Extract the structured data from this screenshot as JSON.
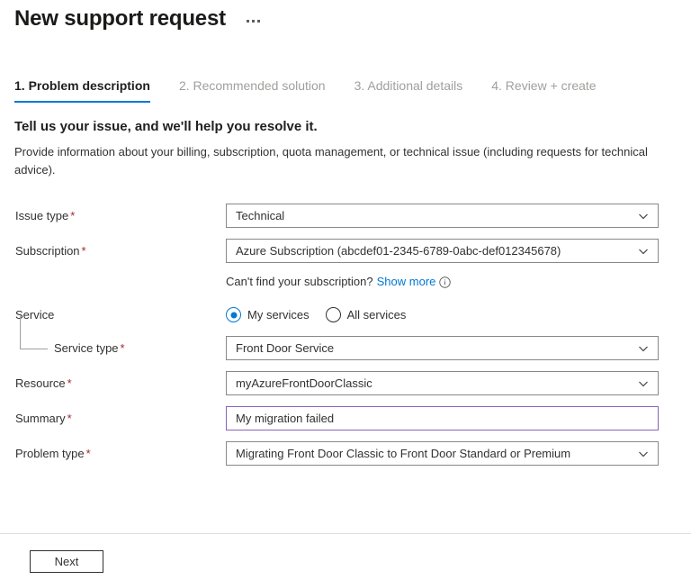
{
  "header": {
    "title": "New support request",
    "more_menu": "..."
  },
  "tabs": [
    {
      "label": "1. Problem description",
      "active": true
    },
    {
      "label": "2. Recommended solution",
      "active": false
    },
    {
      "label": "3. Additional details",
      "active": false
    },
    {
      "label": "4. Review + create",
      "active": false
    }
  ],
  "intro": {
    "heading": "Tell us your issue, and we'll help you resolve it.",
    "body": "Provide information about your billing, subscription, quota management, or technical issue (including requests for technical advice)."
  },
  "form": {
    "issue_type": {
      "label": "Issue type",
      "required": "*",
      "value": "Technical"
    },
    "subscription": {
      "label": "Subscription",
      "required": "*",
      "value": "Azure Subscription (abcdef01-2345-6789-0abc-def012345678)"
    },
    "subscription_helper": {
      "text": "Can't find your subscription?",
      "link": "Show more",
      "info_icon": "info-icon"
    },
    "service": {
      "label": "Service",
      "options": [
        {
          "label": "My services",
          "selected": true
        },
        {
          "label": "All services",
          "selected": false
        }
      ]
    },
    "service_type": {
      "label": "Service type",
      "required": "*",
      "value": "Front Door Service"
    },
    "resource": {
      "label": "Resource",
      "required": "*",
      "value": "myAzureFrontDoorClassic"
    },
    "summary": {
      "label": "Summary",
      "required": "*",
      "value": "My migration failed"
    },
    "problem_type": {
      "label": "Problem type",
      "required": "*",
      "value": "Migrating Front Door Classic to Front Door Standard or Premium"
    }
  },
  "footer": {
    "next_label": "Next"
  },
  "colors": {
    "accent": "#0078d4",
    "required": "#a4262c",
    "active_field_border": "#8764b8",
    "field_border": "#8a8886",
    "inactive_tab": "#a19f9d"
  }
}
